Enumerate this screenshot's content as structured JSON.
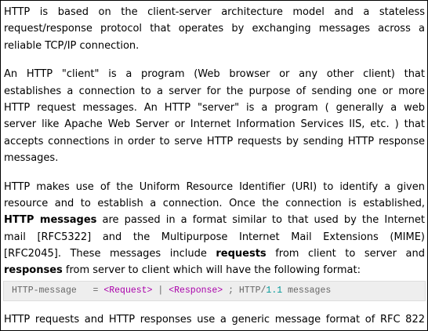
{
  "paragraphs": {
    "p1": [
      "HTTP is based on the client-server architecture model and a stateless",
      "request/response protocol that operates by exchanging messages across a",
      "reliable TCP/IP connection."
    ],
    "p2": [
      "An HTTP \"client\" is a program (Web browser or any other client) that",
      "establishes a connection to a server for the purpose of sending one or more",
      "HTTP request messages. An HTTP \"server\" is a program ( generally a web",
      "server like Apache Web Server or Internet Information Services IIS, etc. ) that",
      "accepts connections in order to serve HTTP requests by sending HTTP response",
      "messages."
    ],
    "p3": {
      "l1": "HTTP makes use of the Uniform Resource Identifier (URI) to identify a given",
      "l2": "resource and to establish a connection. Once the connection is established,",
      "l3_bold": "HTTP messages",
      "l3_rest": " are passed in a format similar to that used by the Internet",
      "l4": "mail [RFC5322] and the Multipurpose Internet Mail Extensions (MIME)",
      "l5_pre": "[RFC2045]. These messages include ",
      "l5_bold": "requests",
      "l5_rest": " from client to server and",
      "l6_bold": "responses",
      "l6_rest": " from server to client which will have the following format:"
    }
  },
  "code": {
    "name": "HTTP-message",
    "eq": "   = ",
    "request": "<Request>",
    "pipe": " | ",
    "response": "<Response>",
    "comment_pre": " ; HTTP/",
    "version": "1.1",
    "comment_post": " messages"
  },
  "cutoff_line": "HTTP requests and HTTP responses use a generic message format of RFC 822"
}
